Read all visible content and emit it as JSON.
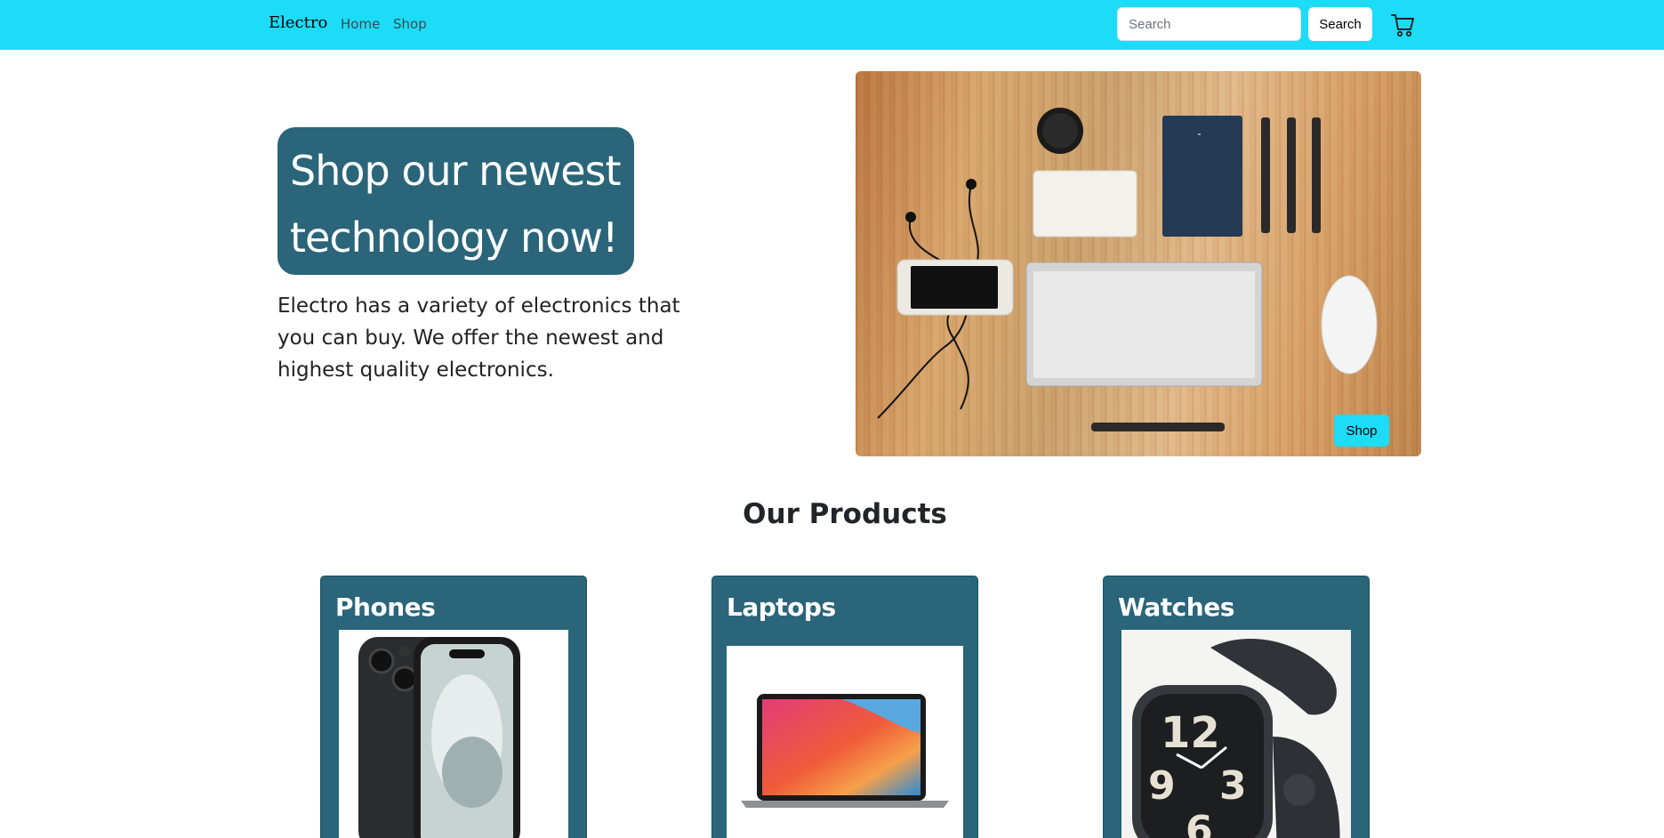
{
  "navbar": {
    "brand": "Electro",
    "links": [
      "Home",
      "Shop"
    ],
    "search_placeholder": "Search",
    "search_button": "Search",
    "cart_icon": "cart-icon",
    "background": "#1cdcf7"
  },
  "hero": {
    "title": "Shop our newest technology now!",
    "description": "Electro has a variety of electronics that you can buy. We offer the newest and highest quality electronics.",
    "shop_button": "Shop",
    "title_box_color": "#2a6579"
  },
  "products": {
    "heading": "Our Products",
    "cards": [
      {
        "title": "Phones"
      },
      {
        "title": "Laptops"
      },
      {
        "title": "Watches"
      }
    ]
  }
}
